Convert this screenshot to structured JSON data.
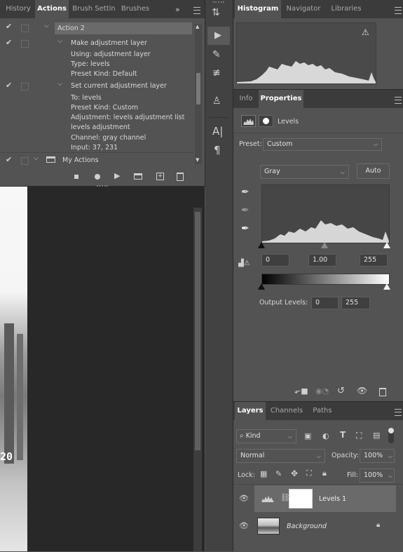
{
  "left_panel": {
    "tabs": [
      "History",
      "Actions",
      "Brush Settin",
      "Brushes"
    ],
    "active_tab": "Actions",
    "actions": [
      {
        "text": "Action 2"
      },
      {
        "text": "Make adjustment layer"
      },
      {
        "text": "Using: adjustment layer"
      },
      {
        "text": "Type: levels"
      },
      {
        "text": "Preset Kind: Default"
      },
      {
        "text": "Set current adjustment layer"
      },
      {
        "text": "To: levels"
      },
      {
        "text": "Preset Kind: Custom"
      },
      {
        "text": "Adjustment: levels adjustment list"
      },
      {
        "text": "levels adjustment"
      },
      {
        "text": "Channel: gray channel"
      },
      {
        "text": "Input: 37, 231"
      },
      {
        "text": "My Actions"
      }
    ]
  },
  "canvas": {
    "partial_number": "20"
  },
  "histogram_panel": {
    "tabs": [
      "Histogram",
      "Navigator",
      "Libraries"
    ],
    "active_tab": "Histogram",
    "warning_icon": "warning-icon"
  },
  "properties_panel": {
    "tabs": [
      "Info",
      "Properties"
    ],
    "active_tab": "Properties",
    "title": "Levels",
    "preset_label": "Preset:",
    "preset_value": "Custom",
    "channel_value": "Gray",
    "auto_label": "Auto",
    "input_black": "0",
    "input_gamma": "1.00",
    "input_white": "255",
    "output_label": "Output Levels:",
    "output_black": "0",
    "output_white": "255"
  },
  "layers_panel": {
    "tabs": [
      "Layers",
      "Channels",
      "Paths"
    ],
    "active_tab": "Layers",
    "kind_label": "Kind",
    "blend_mode": "Normal",
    "opacity_label": "Opacity:",
    "opacity_value": "100%",
    "lock_label": "Lock:",
    "fill_label": "Fill:",
    "fill_value": "100%",
    "layers": [
      {
        "name": "Levels 1",
        "selected": true
      },
      {
        "name": "Background",
        "selected": false,
        "locked": true
      }
    ]
  }
}
